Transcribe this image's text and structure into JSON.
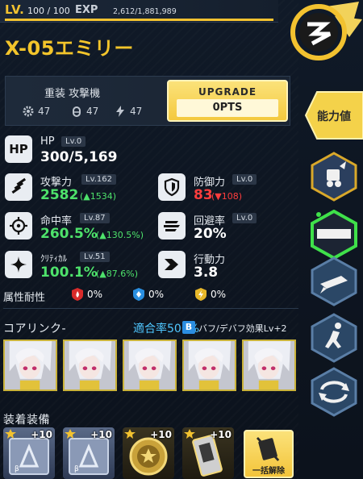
{
  "header": {
    "lv_label": "LV.",
    "lv_value": "100 / 100",
    "exp_label": "EXP",
    "exp_value": "2,612/1,881,989",
    "exp_progress": 1.0
  },
  "character": {
    "name": "X-05エミリー"
  },
  "class_panel": {
    "class_name": "重装 攻撃機",
    "stats": [
      {
        "icon": "gear-icon",
        "value": "47"
      },
      {
        "icon": "bullet-icon",
        "value": "47"
      },
      {
        "icon": "lightning-icon",
        "value": "47"
      }
    ],
    "upgrade_label": "UPGRADE",
    "upgrade_pts": "0PTS"
  },
  "stats": {
    "hp": {
      "icon_text": "HP",
      "name": "HP",
      "lv": "Lv.0",
      "value": "300/5,169"
    },
    "attack": {
      "name": "攻撃力",
      "lv": "Lv.162",
      "value": "2582",
      "delta": "(▲1534)"
    },
    "defense": {
      "name": "防御力",
      "lv": "Lv.0",
      "value": "83",
      "delta": "(▼108)"
    },
    "accuracy": {
      "name": "命中率",
      "lv": "Lv.87",
      "value": "260.5%",
      "delta": "(▲130.5%)"
    },
    "evasion": {
      "name": "回避率",
      "lv": "Lv.0",
      "value": "20%"
    },
    "critical": {
      "name": "ｸﾘﾃｨｶﾙ",
      "lv": "Lv.51",
      "value": "100.1%",
      "delta": "(▲87.6%)"
    },
    "action": {
      "name": "行動力",
      "value": "3.8"
    }
  },
  "resistance": {
    "label": "属性耐性",
    "items": [
      {
        "icon": "fire-icon",
        "value": "0%",
        "color": "#d92b2b"
      },
      {
        "icon": "ice-icon",
        "value": "0%",
        "color": "#2a8fe0"
      },
      {
        "icon": "electric-icon",
        "value": "0%",
        "color": "#e8b82a"
      }
    ]
  },
  "core_link": {
    "label": "コアリンク-",
    "rate_label": "適合率500%",
    "buff_badge": "B",
    "buff_text": "バフ/デバフ効果Lv+2",
    "portrait_count": 5
  },
  "equipment": {
    "label": "装着装備",
    "slots": [
      {
        "plus": "+10",
        "type": "chip"
      },
      {
        "plus": "+10",
        "type": "chip"
      },
      {
        "plus": "+10",
        "type": "medal"
      },
      {
        "plus": "+10",
        "type": "gun"
      }
    ],
    "unequip_label": "一括解除"
  },
  "side_tabs": {
    "active_label": "能力値",
    "tabs": [
      "equipment-tab",
      "bar-tab",
      "missile-tab",
      "runner-tab",
      "cycle-tab"
    ]
  },
  "colors": {
    "accent": "#f3c52b",
    "positive": "#4ee26b",
    "negative": "#ff3d3d",
    "link": "#4fc7ff"
  }
}
